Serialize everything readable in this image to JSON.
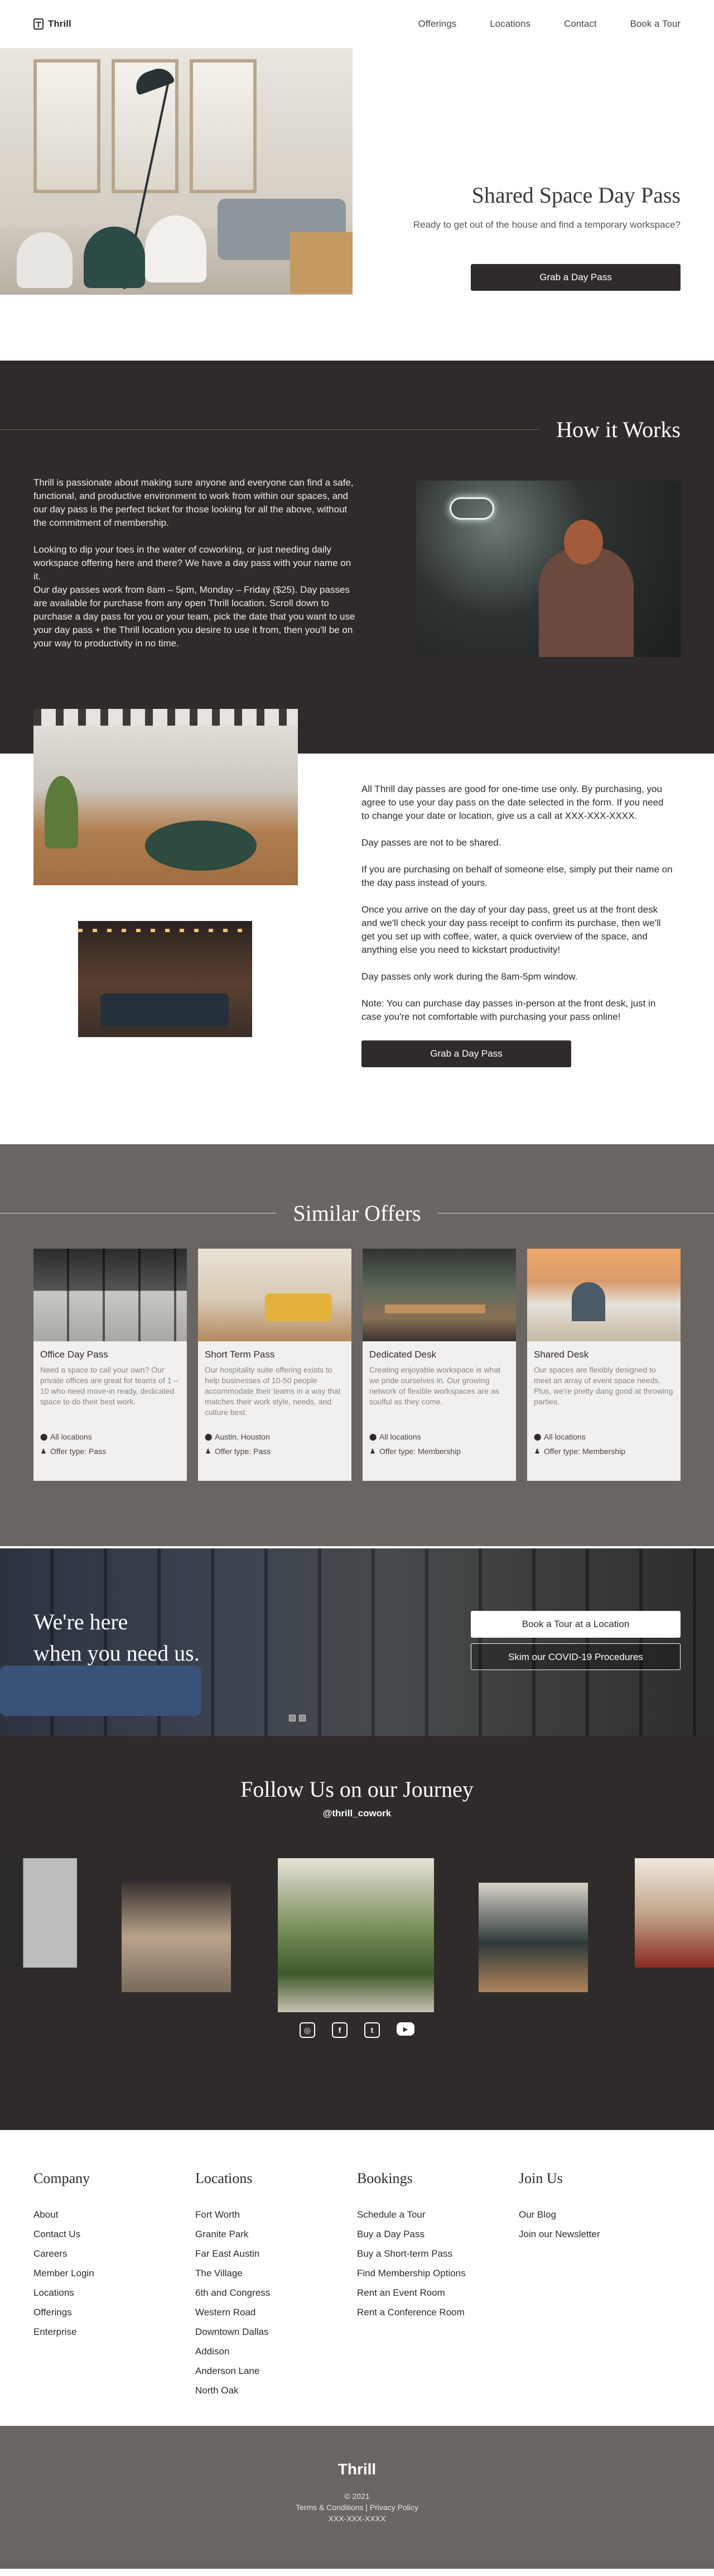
{
  "header": {
    "logo_text": "Thrill",
    "nav": [
      "Offerings",
      "Locations",
      "Contact",
      "Book a Tour"
    ]
  },
  "hero": {
    "title": "Shared Space Day Pass",
    "subtitle": "Ready to get out of the house and find a temporary workspace?",
    "button": "Grab a Day Pass"
  },
  "how": {
    "title": "How it Works",
    "p1": "Thrill is passionate about making sure anyone and everyone can find a safe, functional, and productive environment to work from within our spaces, and our day pass is the perfect ticket for those looking for all the above, without the commitment of membership.",
    "p2": "Looking to dip your toes in the water of coworking, or just needing daily workspace offering here and there? We have a day pass with your name on it.",
    "p3": "Our day passes work from 8am – 5pm, Monday – Friday ($25). Day passes are available for purchase from any open Thrill location. Scroll down to purchase a day pass for you or your team, pick the date that you want to use your day pass + the Thrill location you desire to use it from, then you'll be on your way to productivity in no time."
  },
  "info": {
    "p1": "All Thrill day passes are good for one-time use only. By purchasing, you agree to use your day pass on the date selected in the form. If you need to change your date or location, give us a call at XXX-XXX-XXXX.",
    "p2": "Day passes are not to be shared.",
    "p3": "If you are purchasing on behalf of someone else, simply put their name on the day pass instead of yours.",
    "p4": "Once you arrive on the day of your day pass, greet us at the front desk and we'll check your day pass receipt to confirm its purchase, then we'll get you set up with coffee, water, a quick overview of the space, and anything else you need to kickstart productivity!",
    "p5": "Day passes only work during the 8am-5pm window.",
    "p6": "Note: You can purchase day passes in-person at the front desk, just in case you're not comfortable with purchasing your pass online!",
    "button": "Grab a Day Pass"
  },
  "offers": {
    "title": "Similar Offers",
    "cards": [
      {
        "title": "Office Day Pass",
        "desc": "Need a space to call your own? Our private offices are great for teams of 1 – 10 who need move-in ready, dedicated space to do their best work.",
        "location": "All locations",
        "type": "Offer type: Pass"
      },
      {
        "title": "Short Term Pass",
        "desc": "Our hospitality suite offering exists to help businesses of 10-50 people accommodate their teams in a way that matches their work style, needs, and culture best.",
        "location": "Austin, Houston",
        "type": "Offer type: Pass"
      },
      {
        "title": "Dedicated Desk",
        "desc": "Creating enjoyable workspace is what we pride ourselves in. Our growing network of flexible workspaces are as soulful as they come.",
        "location": "All locations",
        "type": "Offer type: Membership"
      },
      {
        "title": "Shared Desk",
        "desc": "Our spaces are flexibly designed to meet an array of event space needs. Plus, we're pretty dang good at throwing parties.",
        "location": "All locations",
        "type": "Offer type: Membership"
      }
    ]
  },
  "banner": {
    "line1": "We're here",
    "line2": "when you need us.",
    "btn_tour": "Book a Tour at a Location",
    "btn_covid": "Skim our COVID-19 Procedures"
  },
  "follow": {
    "title": "Follow Us on our Journey",
    "handle": "@thrill_cowork",
    "icons": [
      "instagram-icon",
      "facebook-icon",
      "twitter-icon",
      "youtube-icon"
    ]
  },
  "links": {
    "company": {
      "title": "Company",
      "items": [
        "About",
        "Contact Us",
        "Careers",
        "Member Login",
        "Locations",
        "Offerings",
        "Enterprise"
      ]
    },
    "locations": {
      "title": "Locations",
      "items": [
        "Fort Worth",
        "Granite Park",
        "Far East Austin",
        "The Village",
        "6th and Congress",
        "Western Road",
        "Downtown Dallas",
        "Addison",
        "Anderson Lane",
        "North Oak"
      ]
    },
    "bookings": {
      "title": "Bookings",
      "items": [
        "Schedule a Tour",
        "Buy a Day Pass",
        "Buy a Short-term Pass",
        "Find Membership Options",
        "Rent an Event Room",
        "Rent a Conference Room"
      ]
    },
    "join": {
      "title": "Join Us",
      "items": [
        "Our Blog",
        "Join our Newsletter"
      ]
    }
  },
  "bottom": {
    "logo": "Thrill",
    "copyright": "© 2021",
    "terms": "Terms & Conditions",
    "separator": "|",
    "privacy": "Privacy Policy",
    "phone": "XXX-XXX-XXXX"
  },
  "colors": {
    "dark": "#2f2b2a",
    "taupe": "#6a6561",
    "light_card": "#f1f0ee"
  }
}
